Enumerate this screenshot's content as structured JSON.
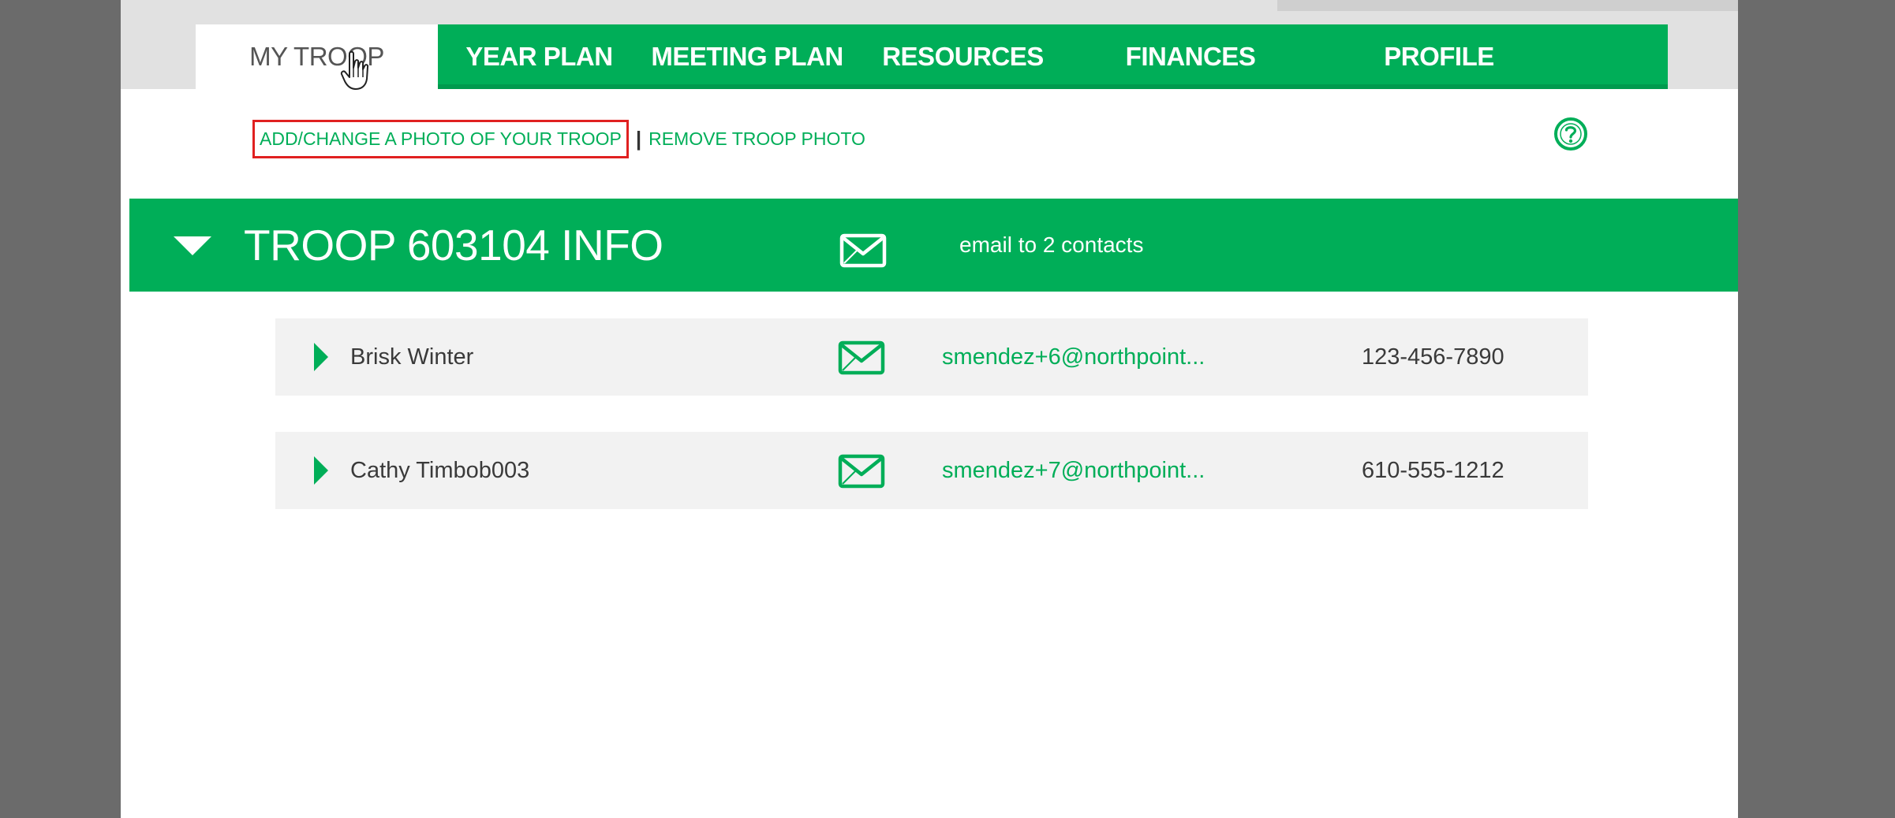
{
  "nav": {
    "tabs": [
      {
        "label": "MY TROOP",
        "active": true
      },
      {
        "label": "YEAR PLAN",
        "active": false
      },
      {
        "label": "MEETING PLAN",
        "active": false
      },
      {
        "label": "RESOURCES",
        "active": false
      },
      {
        "label": "FINANCES",
        "active": false
      },
      {
        "label": "PROFILE",
        "active": false
      }
    ]
  },
  "photo_links": {
    "add_change": "ADD/CHANGE A PHOTO OF YOUR TROOP",
    "separator": "|",
    "remove": "REMOVE TROOP PHOTO"
  },
  "troop": {
    "title": "TROOP 603104 INFO",
    "email_contacts": "email to 2 contacts"
  },
  "contacts": [
    {
      "name": "Brisk Winter",
      "email": "smendez+6@northpoint...",
      "phone": "123-456-7890"
    },
    {
      "name": "Cathy Timbob003",
      "email": "smendez+7@northpoint...",
      "phone": "610-555-1212"
    }
  ],
  "colors": {
    "brand_green": "#00ae58",
    "highlight_red": "#e02020",
    "backdrop_gray": "#6b6b6b"
  },
  "icons": {
    "help": "help-circle-icon",
    "mail": "envelope-icon",
    "expand": "triangle-down-icon",
    "row_expand": "caret-right-icon",
    "cursor": "hand-pointer-icon"
  }
}
